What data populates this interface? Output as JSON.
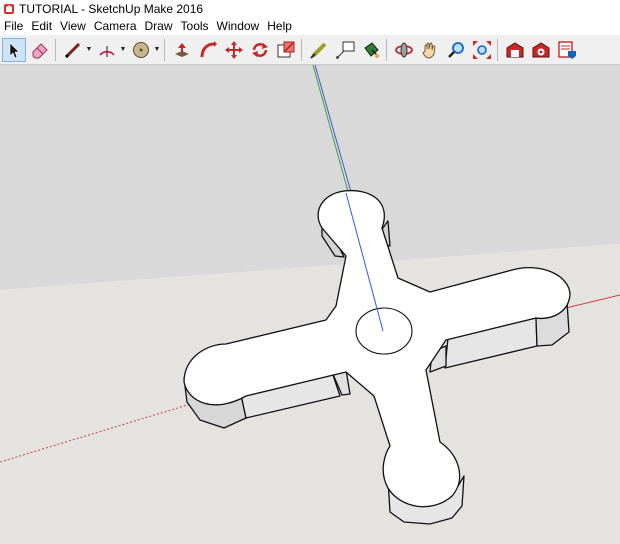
{
  "window": {
    "title": "TUTORIAL - SketchUp Make 2016"
  },
  "menu": [
    "File",
    "Edit",
    "View",
    "Camera",
    "Draw",
    "Tools",
    "Window",
    "Help"
  ],
  "toolbar": {
    "tools": [
      "select",
      "eraser",
      "pencil",
      "arc",
      "circle",
      "push-pull",
      "follow-me",
      "move",
      "rotate",
      "scale",
      "tape-measure",
      "text",
      "paint-bucket",
      "orbit",
      "pan",
      "zoom",
      "zoom-extents",
      "warehouse",
      "extension-warehouse",
      "layout"
    ],
    "active_tool": "select"
  },
  "colors": {
    "sky": "#d9d9d9",
    "ground": "#e4e3df",
    "model_top": "#ffffff",
    "model_side": "#e6e6e6",
    "blue_axis": "#3a58d8",
    "green_axis": "#3aa03a",
    "red_axis": "#d04040"
  }
}
